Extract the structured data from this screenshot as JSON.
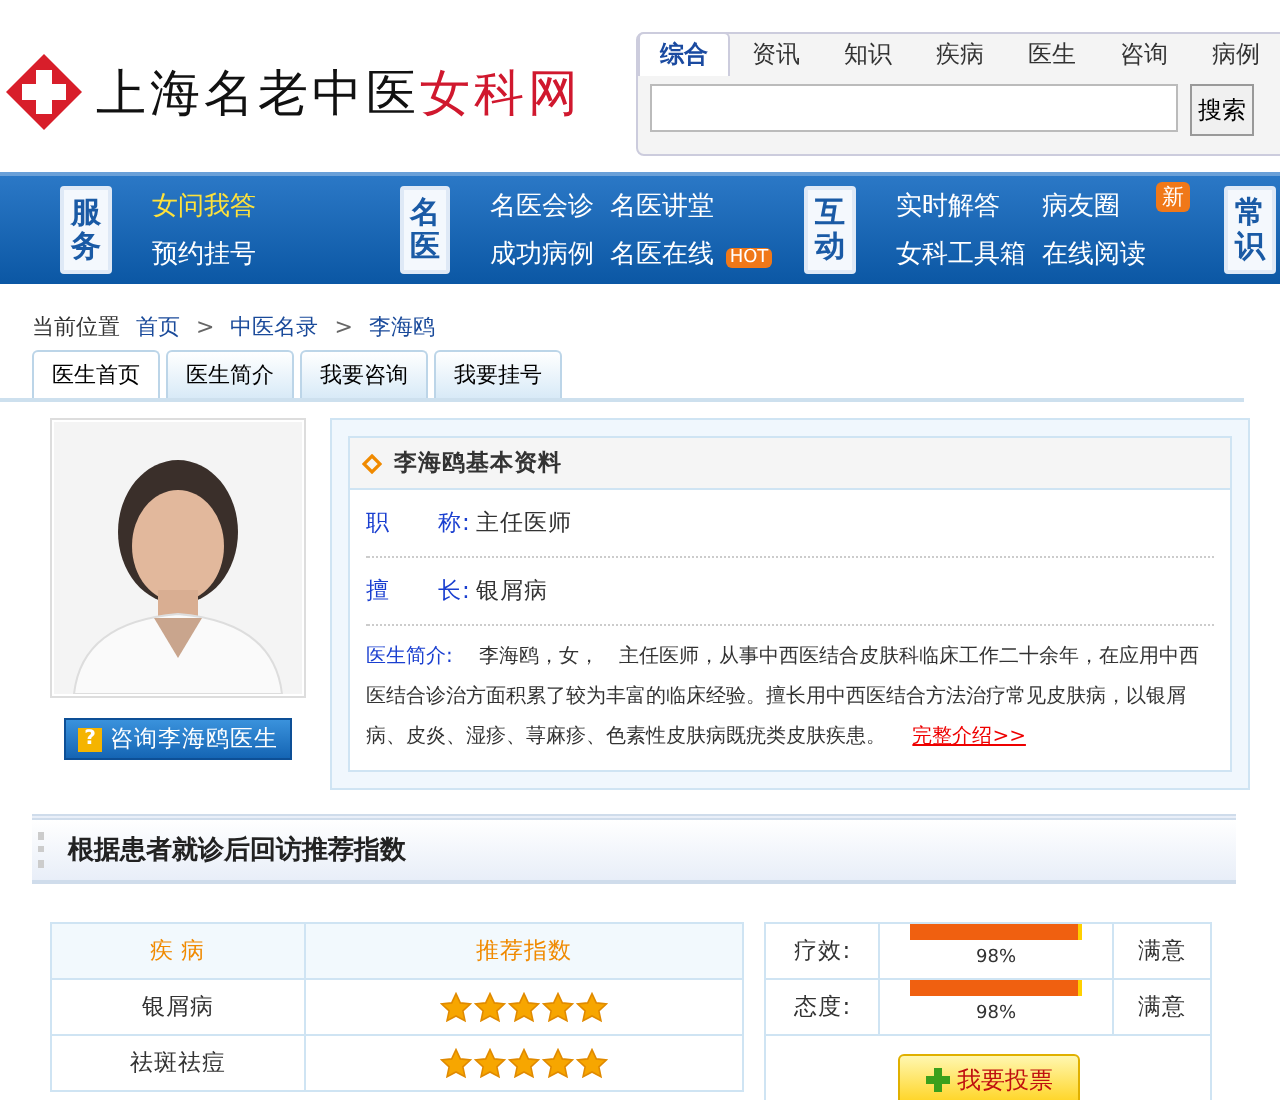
{
  "logo": {
    "title": "上海名老中医",
    "highlight": "女科网"
  },
  "search": {
    "tabs": [
      {
        "label": "综合",
        "selected": true
      },
      {
        "label": "资讯",
        "selected": false
      },
      {
        "label": "知识",
        "selected": false
      },
      {
        "label": "疾病",
        "selected": false
      },
      {
        "label": "医生",
        "selected": false
      },
      {
        "label": "咨询",
        "selected": false
      },
      {
        "label": "病例",
        "selected": false
      }
    ],
    "button": "搜索"
  },
  "nav": [
    {
      "label": "服务",
      "links": [
        {
          "text": "女问我答",
          "highlight": true
        },
        {
          "text": "预约挂号",
          "highlight": false
        }
      ]
    },
    {
      "label": "名医",
      "links": [
        {
          "text": "名医会诊",
          "highlight": false
        },
        {
          "text": "名医讲堂",
          "highlight": false
        },
        {
          "text": "成功病例",
          "highlight": false
        },
        {
          "text": "名医在线",
          "highlight": false,
          "badge": "HOT"
        }
      ]
    },
    {
      "label": "互动",
      "links": [
        {
          "text": "实时解答",
          "highlight": false
        },
        {
          "text": "病友圈",
          "highlight": false,
          "badge": "新"
        },
        {
          "text": "女科工具箱",
          "highlight": false
        },
        {
          "text": "在线阅读",
          "highlight": false
        }
      ]
    },
    {
      "label": "常识"
    }
  ],
  "breadcrumb": {
    "label": "当前位置",
    "separator": ">",
    "items": [
      "首页",
      "中医名录",
      "李海鸥"
    ]
  },
  "tabs": [
    {
      "label": "医生首页",
      "selected": true
    },
    {
      "label": "医生简介",
      "selected": false
    },
    {
      "label": "我要咨询",
      "selected": false
    },
    {
      "label": "我要挂号",
      "selected": false
    }
  ],
  "doctor": {
    "consult_icon": "?",
    "consult_button": "咨询李海鸥医生",
    "profile_title": "李海鸥基本资料",
    "fields": [
      {
        "label": "职　　称:",
        "value": "主任医师"
      },
      {
        "label": "擅　　长:",
        "value": "银屑病"
      }
    ],
    "intro_label": "医生简介:",
    "intro": "李海鸥，女，　主任医师，从事中西医结合皮肤科临床工作二十余年，在应用中西医结合诊治方面积累了较为丰富的临床经验。擅长用中西医结合方法治疗常见皮肤病，以银屑病、皮炎、湿疹、荨麻疹、色素性皮肤病既疣类皮肤疾患。",
    "more_link": "完整介绍>>"
  },
  "recommend": {
    "title": "根据患者就诊后回访推荐指数",
    "table": {
      "columns": [
        "疾 病",
        "推荐指数"
      ],
      "rows": [
        {
          "disease": "银屑病",
          "stars": 5
        },
        {
          "disease": "祛斑祛痘",
          "stars": 5
        }
      ]
    },
    "ratings": [
      {
        "label": "疗效:",
        "level": 0.98,
        "reading": "98%",
        "result": "满意"
      },
      {
        "label": "态度:",
        "level": 0.98,
        "reading": "98%",
        "result": "满意"
      }
    ],
    "vote_button": "我要投票"
  }
}
